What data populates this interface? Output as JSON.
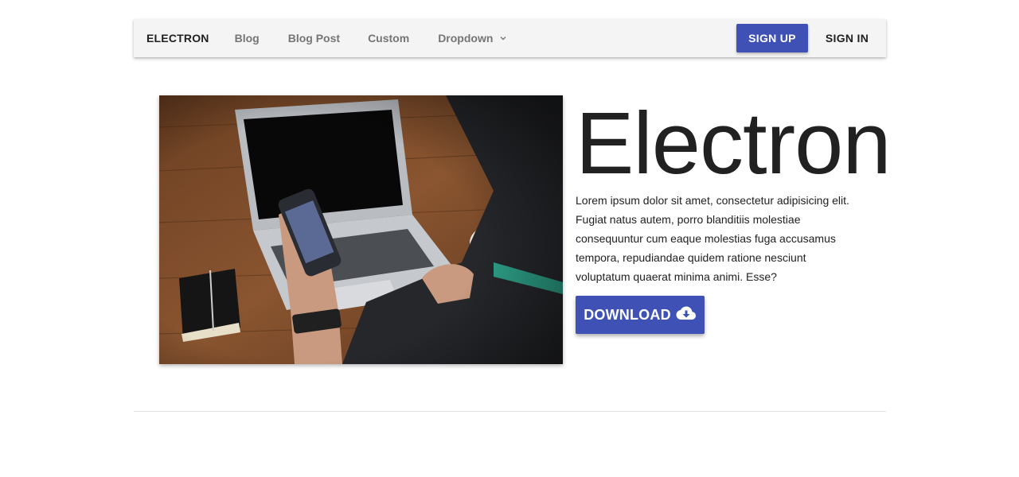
{
  "navbar": {
    "brand": "ELECTRON",
    "links": [
      {
        "label": "Blog"
      },
      {
        "label": "Blog Post"
      },
      {
        "label": "Custom"
      },
      {
        "label": "Dropdown"
      }
    ],
    "signup_label": "SIGN UP",
    "signin_label": "SIGN IN"
  },
  "hero": {
    "title": "Electron",
    "body": "Lorem ipsum dolor sit amet, consectetur adipisicing elit. Fugiat natus autem, porro blanditiis molestiae consequuntur cum eaque molestias fuga accusamus tempora, repudiandae quidem ratione nesciunt voluptatum quaerat minima animi. Esse?",
    "download_label": "DOWNLOAD",
    "download_icon": "cloud-download-icon",
    "image": "laptop-phone-photo"
  },
  "colors": {
    "accent": "#3f51b5",
    "navbar_bg": "#f4f4f4",
    "text": "#212121",
    "muted": "#757575"
  }
}
